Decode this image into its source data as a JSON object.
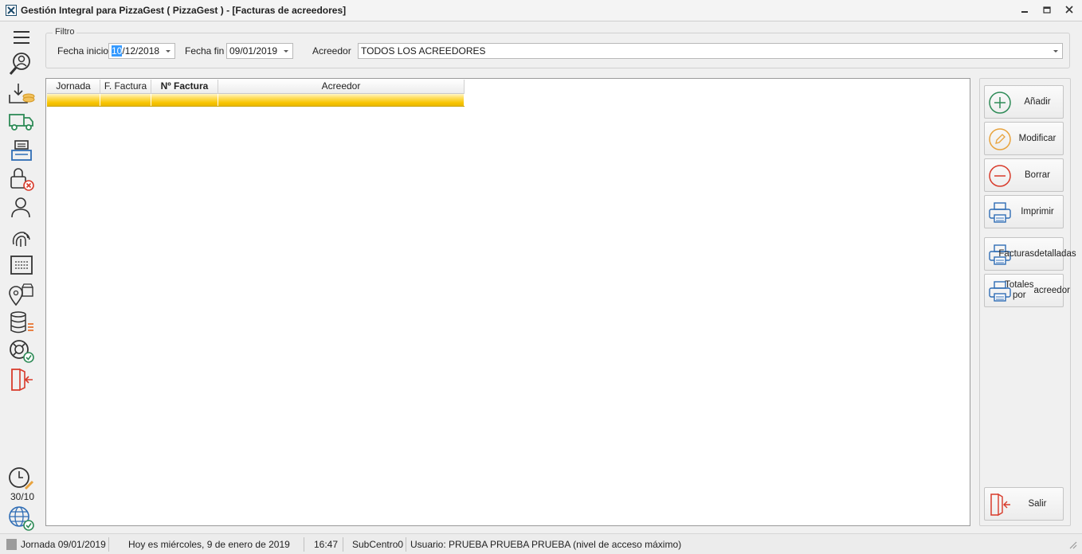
{
  "window": {
    "title": "Gestión Integral para PizzaGest ( PizzaGest ) - [Facturas de acreedores]",
    "controls": [
      "minimize",
      "restore",
      "close"
    ]
  },
  "sidebar": {
    "icons": [
      "menu-icon",
      "search-user-icon",
      "inbox-coins-icon",
      "delivery-truck-icon",
      "cash-register-icon",
      "lock-error-icon",
      "employee-icon",
      "fingerprint-icon",
      "keyboard-icon",
      "store-location-icon",
      "database-list-icon",
      "support-check-icon",
      "exit-door-icon",
      "clock-edit-icon",
      "globe-check-icon"
    ],
    "date_label": "30/10"
  },
  "filter": {
    "legend": "Filtro",
    "fecha_inicio_label": "Fecha inicio",
    "fecha_inicio_selected": "10",
    "fecha_inicio_rest": "/12/2018",
    "fecha_fin_label": "Fecha fin",
    "fecha_fin_value": "09/01/2019",
    "acreedor_label": "Acreedor",
    "acreedor_value": "TODOS LOS ACREEDORES"
  },
  "grid": {
    "columns": [
      "Jornada",
      "F. Factura",
      "Nº Factura",
      "Acreedor"
    ],
    "rows": [
      [
        "",
        "",
        "",
        ""
      ]
    ]
  },
  "actions": {
    "add": "Añadir",
    "edit": "Modificar",
    "delete": "Borrar",
    "print": "Imprimir",
    "detailed_line1": "Facturas",
    "detailed_line2": "detalladas",
    "totals_line1": "Totales por",
    "totals_line2": "acreedor",
    "exit": "Salir"
  },
  "status": {
    "jornada": "Jornada 09/01/2019",
    "today": "Hoy es miércoles, 9 de enero de 2019",
    "time": "16:47",
    "center": "SubCentro0",
    "user": "Usuario: PRUEBA PRUEBA PRUEBA (nivel de acceso máximo)"
  },
  "colors": {
    "accent_green": "#2e8b57",
    "accent_orange": "#e8a33d",
    "accent_red": "#d83a2a",
    "accent_blue": "#2f6db5",
    "selected_row": "#f7c400"
  }
}
